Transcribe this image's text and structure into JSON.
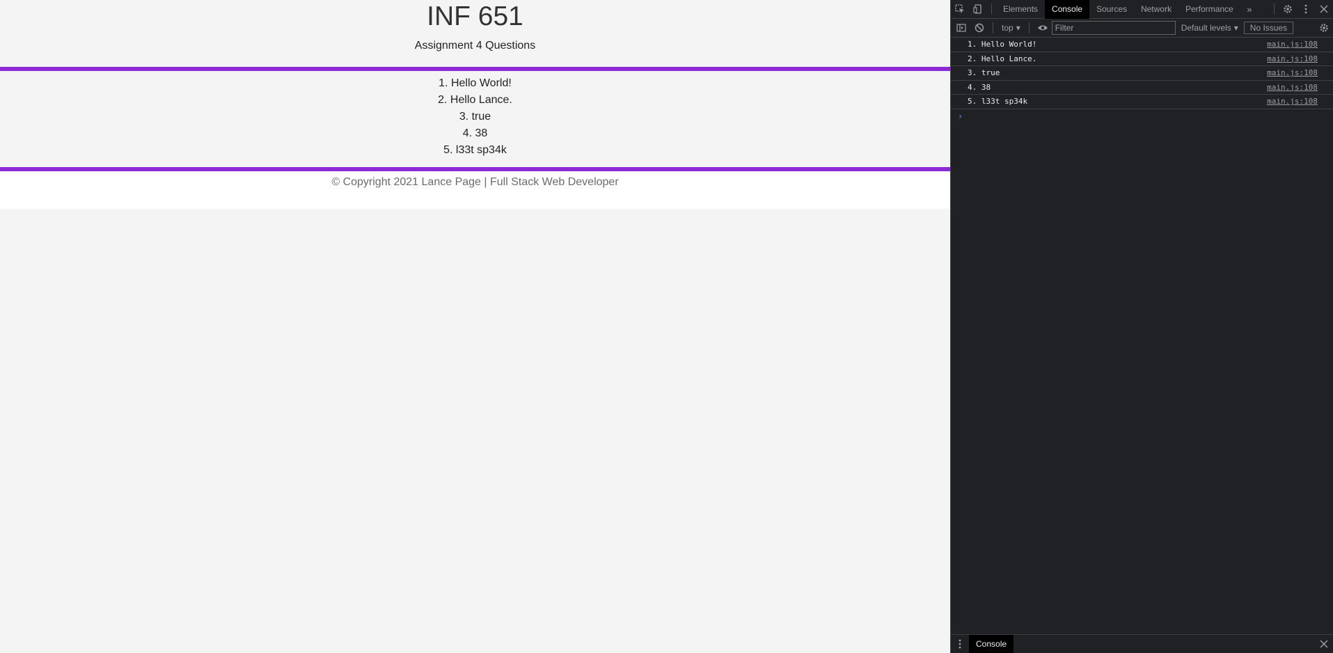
{
  "page": {
    "title": "INF 651",
    "subtitle": "Assignment 4 Questions",
    "answers": [
      "1. Hello World!",
      "2. Hello Lance.",
      "3. true",
      "4. 38",
      "5. l33t sp34k"
    ],
    "footer": "© Copyright 2021 Lance Page | Full Stack Web Developer",
    "accent_color": "#8a2bd5"
  },
  "devtools": {
    "tabs": [
      "Elements",
      "Console",
      "Sources",
      "Network",
      "Performance"
    ],
    "active_tab": "Console",
    "more_tabs": "»",
    "context": "top",
    "filter_placeholder": "Filter",
    "levels": "Default levels",
    "issues": "No Issues",
    "console_logs": [
      {
        "text": "1. Hello World!",
        "source": "main.js:108"
      },
      {
        "text": "2. Hello Lance.",
        "source": "main.js:108"
      },
      {
        "text": "3. true",
        "source": "main.js:108"
      },
      {
        "text": "4. 38",
        "source": "main.js:108"
      },
      {
        "text": "5. l33t sp34k",
        "source": "main.js:108"
      }
    ],
    "prompt": "›",
    "drawer_tab": "Console"
  }
}
